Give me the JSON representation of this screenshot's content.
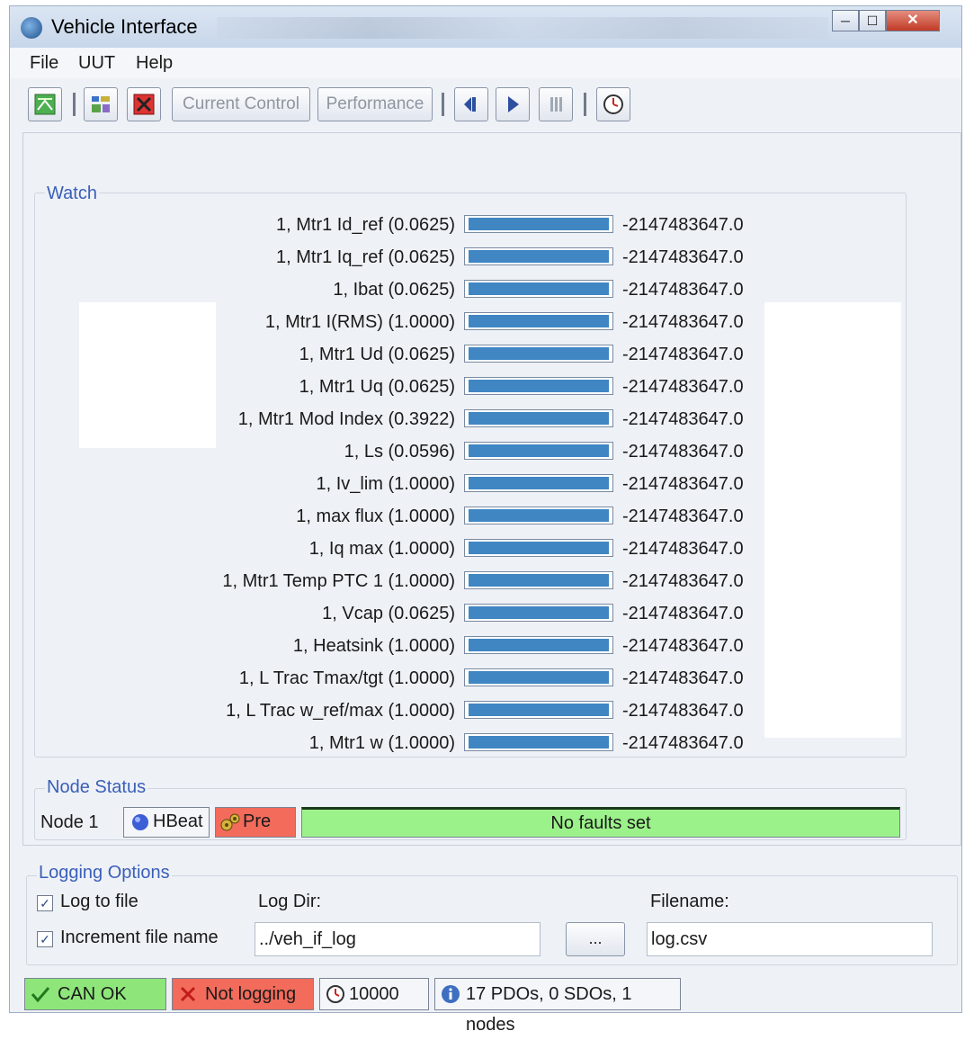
{
  "window": {
    "title": "Vehicle Interface",
    "controls": {
      "minimize": "─",
      "maximize": "☐",
      "close": "✕"
    }
  },
  "menu": [
    "File",
    "UUT",
    "Help"
  ],
  "toolbar": {
    "current_control_label": "Current Control",
    "performance_label": "Performance",
    "icons": [
      "connect-icon",
      "config-icon",
      "stop-icon",
      "step-back-icon",
      "play-icon",
      "pause-icon",
      "clock-icon"
    ]
  },
  "watch": {
    "label": "Watch",
    "rows": [
      {
        "label": "1, Mtr1 Id_ref (0.0625)",
        "value": "-2147483647.0",
        "fill": 1.0
      },
      {
        "label": "1, Mtr1 Iq_ref (0.0625)",
        "value": "-2147483647.0",
        "fill": 1.0
      },
      {
        "label": "1, Ibat (0.0625)",
        "value": "-2147483647.0",
        "fill": 1.0
      },
      {
        "label": "1, Mtr1 I(RMS) (1.0000)",
        "value": "-2147483647.0",
        "fill": 1.0
      },
      {
        "label": "1, Mtr1 Ud (0.0625)",
        "value": "-2147483647.0",
        "fill": 1.0
      },
      {
        "label": "1, Mtr1 Uq (0.0625)",
        "value": "-2147483647.0",
        "fill": 1.0
      },
      {
        "label": "1, Mtr1 Mod Index (0.3922)",
        "value": "-2147483647.0",
        "fill": 1.0
      },
      {
        "label": "1, Ls (0.0596)",
        "value": "-2147483647.0",
        "fill": 1.0
      },
      {
        "label": "1, Iv_lim (1.0000)",
        "value": "-2147483647.0",
        "fill": 1.0
      },
      {
        "label": "1, max flux (1.0000)",
        "value": "-2147483647.0",
        "fill": 1.0
      },
      {
        "label": "1, Iq max (1.0000)",
        "value": "-2147483647.0",
        "fill": 1.0
      },
      {
        "label": "1, Mtr1 Temp PTC 1 (1.0000)",
        "value": "-2147483647.0",
        "fill": 1.0
      },
      {
        "label": "1, Vcap (0.0625)",
        "value": "-2147483647.0",
        "fill": 1.0
      },
      {
        "label": "1, Heatsink (1.0000)",
        "value": "-2147483647.0",
        "fill": 1.0
      },
      {
        "label": "1, L Trac Tmax/tgt (1.0000)",
        "value": "-2147483647.0",
        "fill": 1.0
      },
      {
        "label": "1, L Trac w_ref/max (1.0000)",
        "value": "-2147483647.0",
        "fill": 1.0
      },
      {
        "label": "1, Mtr1 w (1.0000)",
        "value": "-2147483647.0",
        "fill": 1.0
      }
    ]
  },
  "node_status": {
    "label": "Node Status",
    "node_name": "Node 1",
    "hbeat_label": "HBeat",
    "pre_label": "Pre",
    "faults_text": "No faults set",
    "colors": {
      "pre_bg": "#f26b5b",
      "faults_bg": "#9cf28a"
    }
  },
  "logging": {
    "label": "Logging Options",
    "log_to_file_label": "Log to file",
    "log_to_file_checked": true,
    "increment_label": "Increment file name",
    "increment_checked": true,
    "log_dir_label": "Log Dir:",
    "log_dir_value": "../veh_if_log",
    "browse_label": "...",
    "filename_label": "Filename:",
    "filename_value": "log.csv"
  },
  "status_bar": {
    "can_text": "CAN OK",
    "logging_text": "Not logging",
    "counter_text": "10000",
    "info_text": "17 PDOs, 0 SDOs, 1 nodes",
    "colors": {
      "can_bg": "#8ee67a",
      "logging_bg": "#f26b5b"
    }
  }
}
